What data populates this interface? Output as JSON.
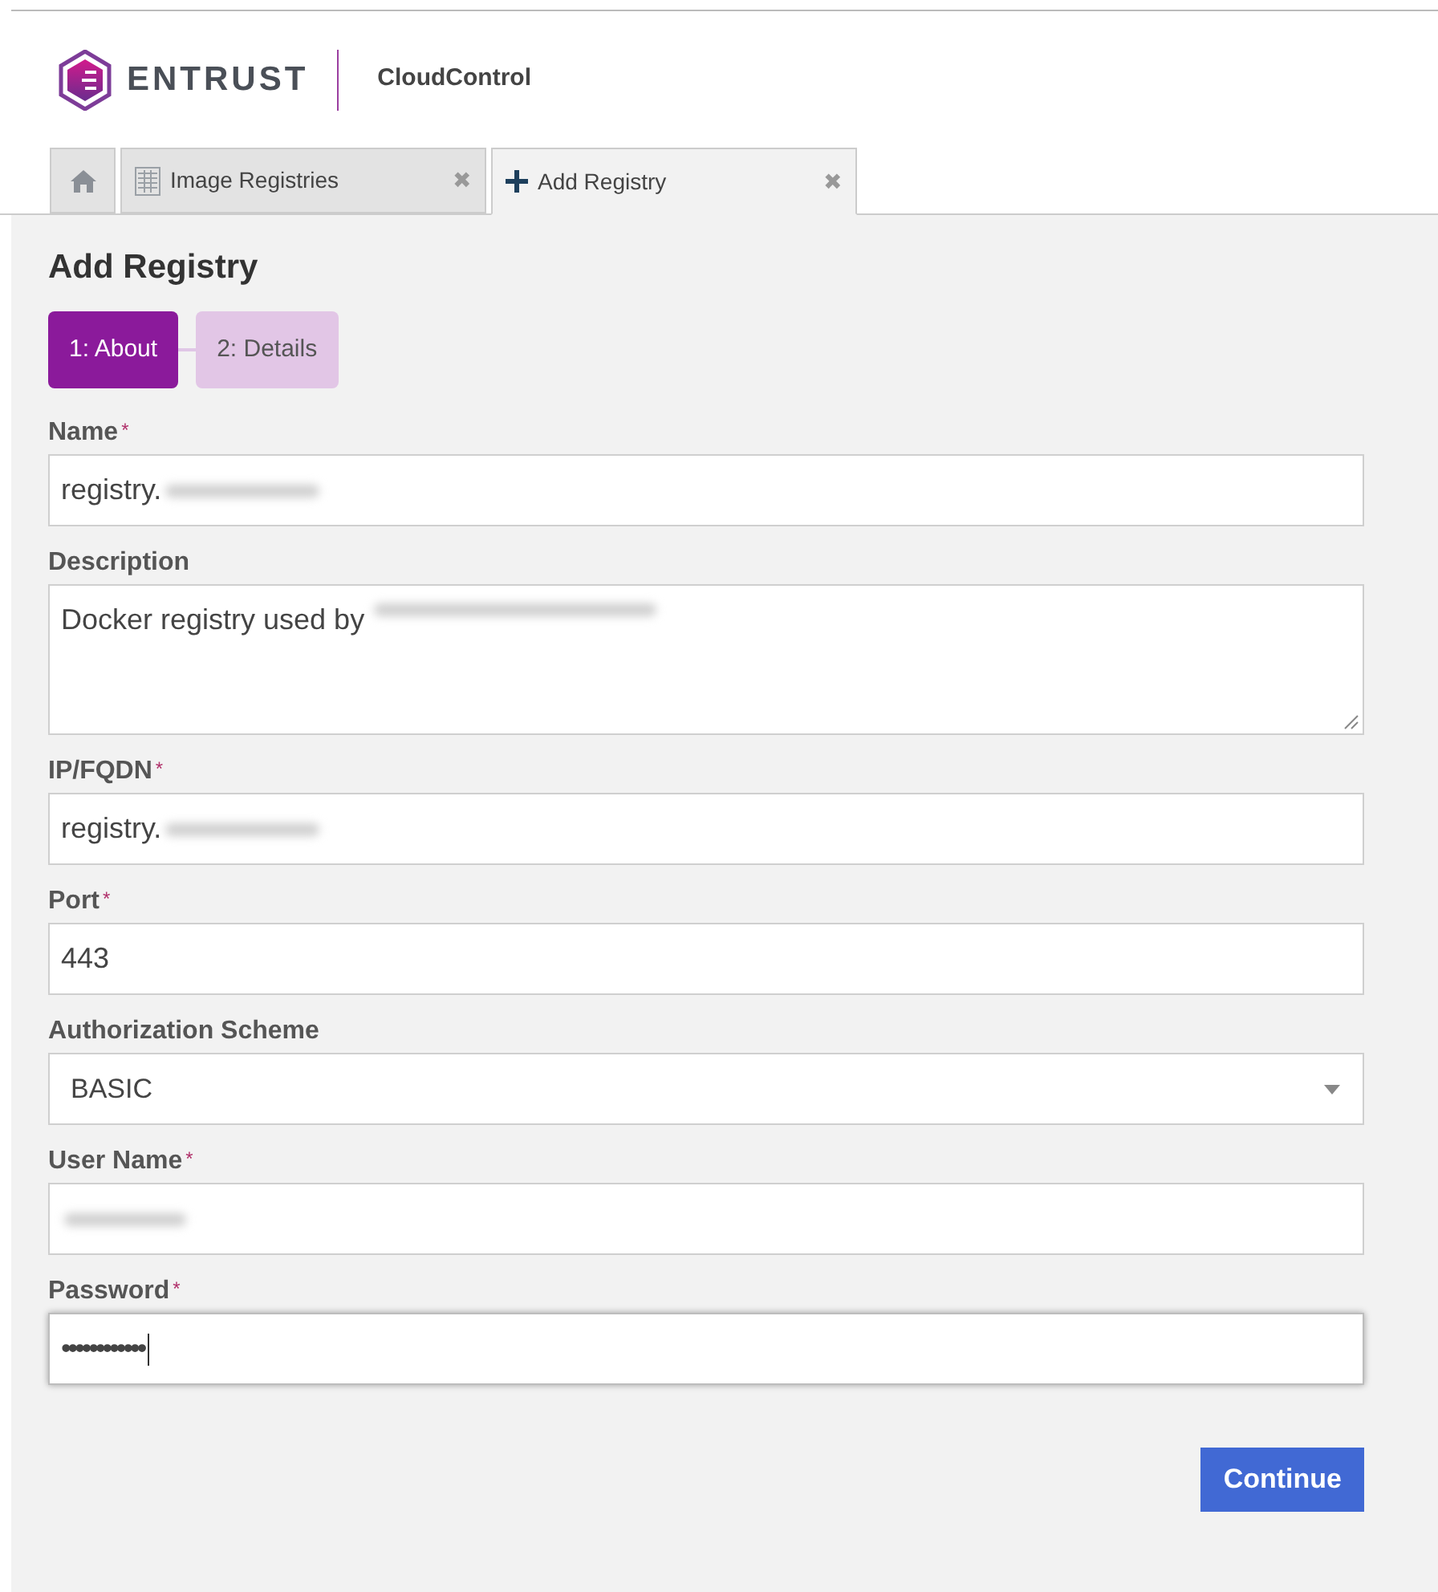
{
  "brand": {
    "logo_text": "ENTRUST",
    "product": "CloudControl"
  },
  "tabs": [
    {
      "kind": "home",
      "selected": false
    },
    {
      "kind": "list",
      "label": "Image Registries",
      "close": "✖",
      "selected": false
    },
    {
      "kind": "add",
      "label": "Add Registry",
      "close": "✖",
      "selected": true
    }
  ],
  "page_title": "Add Registry",
  "steps": [
    {
      "label": "1: About",
      "selected": true
    },
    {
      "label": "2: Details",
      "selected": false
    }
  ],
  "fields": [
    {
      "kind": "text",
      "label": "Name",
      "required_mark": "*",
      "value": "registry.",
      "redacted": true,
      "focused": false
    },
    {
      "kind": "textarea",
      "label": "Description",
      "value": "Docker registry used by",
      "redacted": true,
      "focused": false
    },
    {
      "kind": "text",
      "label": "IP/FQDN",
      "required_mark": "*",
      "value": "registry.",
      "redacted": true,
      "focused": false
    },
    {
      "kind": "text",
      "label": "Port",
      "required_mark": "*",
      "value": "443",
      "redacted": false,
      "focused": false
    },
    {
      "kind": "select",
      "label": "Authorization Scheme",
      "value": "BASIC",
      "redacted": false,
      "focused": false
    },
    {
      "kind": "text",
      "label": "User Name",
      "required_mark": "*",
      "redacted": true,
      "focused": false
    },
    {
      "kind": "password",
      "label": "Password",
      "required_mark": "*",
      "value": "••••••••••••",
      "redacted": false,
      "focused": true
    }
  ],
  "continue_button": "Continue"
}
